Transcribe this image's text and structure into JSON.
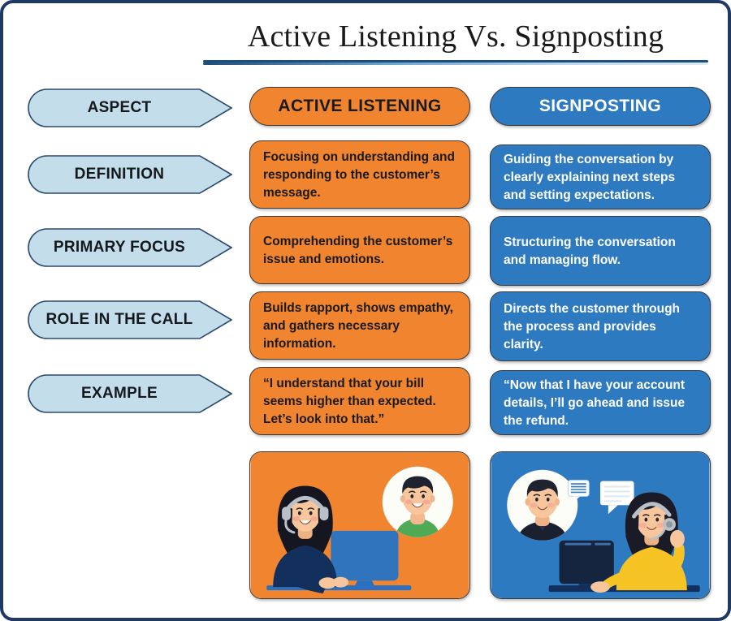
{
  "title": "Active Listening Vs. Signposting",
  "colors": {
    "border": "#1f3864",
    "orange": "#f0842f",
    "blue": "#2e7ac0",
    "light_blue": "#c3deea",
    "title_rule": "#1f4e79"
  },
  "columns": {
    "aspect_header": "ASPECT",
    "active_listening_header": "ACTIVE LISTENING",
    "signposting_header": "SIGNPOSTING"
  },
  "rows": [
    {
      "aspect": "DEFINITION",
      "active_listening": "Focusing on understanding and responding to the customer’s message.",
      "signposting": "Guiding the conversation by clearly explaining next steps and setting  expectations."
    },
    {
      "aspect": "PRIMARY FOCUS",
      "active_listening": "Comprehending the customer’s issue and emotions.",
      "signposting": "Structuring the conversation and managing flow."
    },
    {
      "aspect": "ROLE IN THE CALL",
      "active_listening": "Builds rapport, shows empathy, and gathers necessary information.",
      "signposting": "Directs the customer through the process and provides clarity."
    },
    {
      "aspect": "EXAMPLE",
      "active_listening": "“I understand that your bill seems higher than expected. Let’s look into that.”",
      "signposting": "“Now that I have your account details, I’ll go ahead and issue the refund."
    }
  ],
  "illustrations": {
    "active_listening": "agent-with-headset-at-computer-and-customer-avatar",
    "signposting": "customer-avatar-with-chat-bubbles-and-agent-with-headset"
  }
}
